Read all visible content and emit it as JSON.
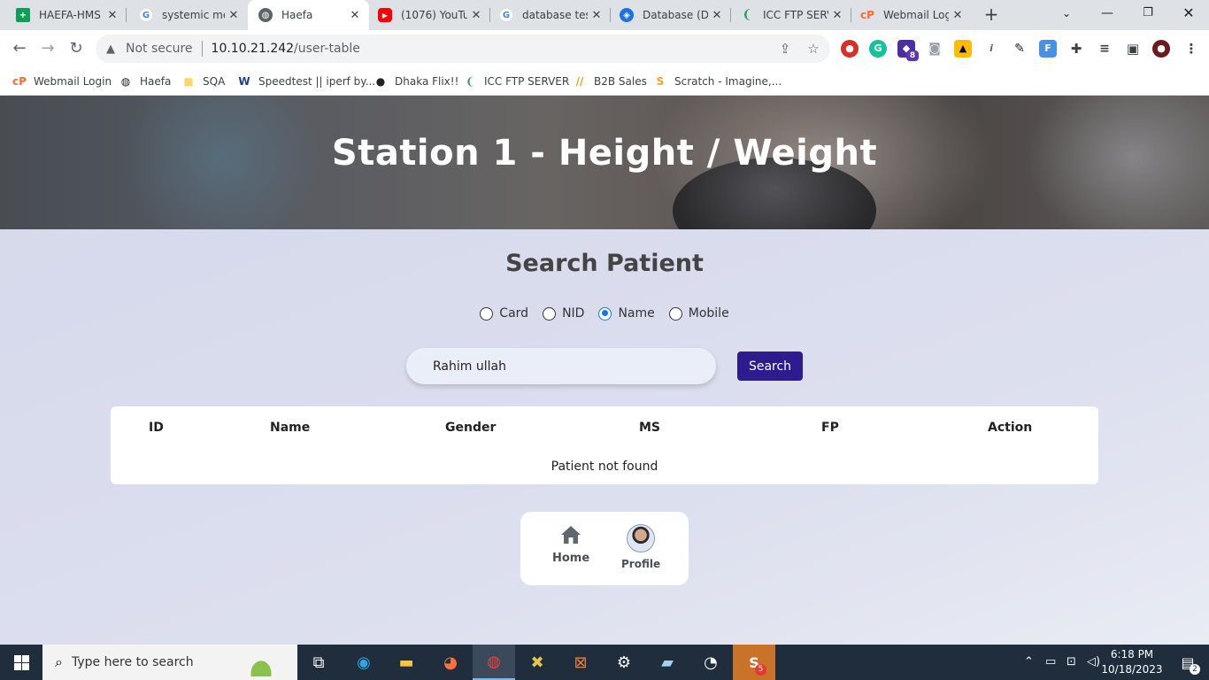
{
  "browser": {
    "tabs": [
      {
        "label": "HAEFA-HMS",
        "icon": "sheets-icon",
        "color": "#0f9d58"
      },
      {
        "label": "systemic me",
        "icon": "google-icon",
        "color": "#4285f4"
      },
      {
        "label": "Haefa",
        "icon": "globe-icon",
        "color": "#5f6368"
      },
      {
        "label": "(1076) YouTu",
        "icon": "youtube-icon",
        "color": "#ff0000"
      },
      {
        "label": "database tes",
        "icon": "google-icon",
        "color": "#4285f4"
      },
      {
        "label": "Database (D",
        "icon": "drawio-icon",
        "color": "#1a73e8"
      },
      {
        "label": "ICC FTP SERV",
        "icon": "icc-icon",
        "color": "#2e9e4f"
      },
      {
        "label": "Webmail Log",
        "icon": "cpanel-icon",
        "color": "#ff6c2c"
      }
    ],
    "new_tab_symbol": "+",
    "address": {
      "security_label": "Not secure",
      "host": "10.10.21.242",
      "path": "/user-table"
    },
    "bookmarks": [
      {
        "label": "Webmail Login",
        "icon": "cpanel-icon",
        "color": "#ff6c2c"
      },
      {
        "label": "Haefa",
        "icon": "globe-icon",
        "color": "#202124"
      },
      {
        "label": "SQA",
        "icon": "folder-icon",
        "color": "#fbd46d"
      },
      {
        "label": "Speedtest || iperf by...",
        "icon": "speedtest-icon",
        "color": "#1c3f94"
      },
      {
        "label": "Dhaka Flix!!",
        "icon": "dhakaflix-icon",
        "color": "#222222"
      },
      {
        "label": "ICC FTP SERVER",
        "icon": "icc-icon",
        "color": "#2e9e4f"
      },
      {
        "label": "B2B Sales",
        "icon": "b2b-icon",
        "color": "#f59e0b"
      },
      {
        "label": "Scratch - Imagine,...",
        "icon": "scratch-icon",
        "color": "#f7a21b"
      }
    ],
    "extension_badge": "8"
  },
  "page": {
    "hero_title": "Station 1 - Height / Weight",
    "search_title": "Search Patient",
    "radios": [
      {
        "label": "Card",
        "checked": false
      },
      {
        "label": "NID",
        "checked": false
      },
      {
        "label": "Name",
        "checked": true
      },
      {
        "label": "Mobile",
        "checked": false
      }
    ],
    "search_value": "Rahim ullah",
    "search_button": "Search",
    "table": {
      "columns": [
        "ID",
        "Name",
        "Gender",
        "MS",
        "FP",
        "Action"
      ],
      "empty_message": "Patient not found"
    },
    "bottom_nav": {
      "home_label": "Home",
      "profile_label": "Profile"
    },
    "accent": "#2d1b8f"
  },
  "taskbar": {
    "search_placeholder": "Type here to search",
    "time": "6:18 PM",
    "date": "10/18/2023",
    "notification_count": "2",
    "chrome_badge": "5"
  }
}
